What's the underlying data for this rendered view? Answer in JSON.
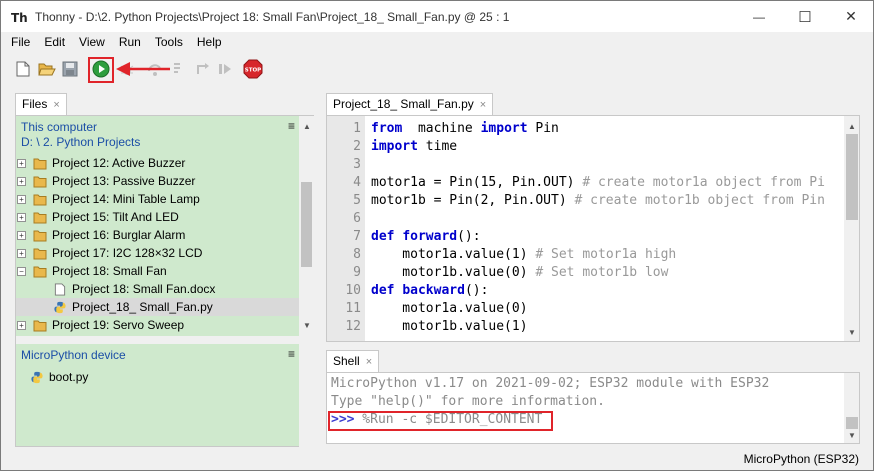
{
  "window": {
    "title": "Thonny  -  D:\\2. Python Projects\\Project 18:  Small Fan\\Project_18_ Small_Fan.py  @  25 : 1",
    "app_icon_text": "Th",
    "minimize": "—",
    "maximize": "☐",
    "close": "✕"
  },
  "menu": [
    "File",
    "Edit",
    "View",
    "Run",
    "Tools",
    "Help"
  ],
  "toolbar": {
    "stop_label": "STOP",
    "highlight_color": "#e0242a"
  },
  "files_panel": {
    "tab_label": "Files",
    "close": "×",
    "computer_label": "This computer",
    "computer_path": "D: \\ 2. Python Projects",
    "menu_glyph": "≡",
    "tree": [
      {
        "label": "Project 12:  Active Buzzer",
        "type": "folder",
        "exp": "+"
      },
      {
        "label": "Project 13:  Passive Buzzer",
        "type": "folder",
        "exp": "+"
      },
      {
        "label": "Project 14:  Mini Table Lamp",
        "type": "folder",
        "exp": "+"
      },
      {
        "label": "Project 15:  Tilt And LED",
        "type": "folder",
        "exp": "+"
      },
      {
        "label": "Project 16:  Burglar Alarm",
        "type": "folder",
        "exp": "+"
      },
      {
        "label": "Project 17:   I2C 128×32 LCD",
        "type": "folder",
        "exp": "+"
      },
      {
        "label": "Project 18:  Small Fan",
        "type": "folder",
        "exp": "−"
      },
      {
        "label": "Project 18:  Small Fan.docx",
        "type": "doc",
        "exp": ""
      },
      {
        "label": "Project_18_ Small_Fan.py",
        "type": "py",
        "exp": "",
        "selected": true
      },
      {
        "label": "Project 19:  Servo Sweep",
        "type": "folder",
        "exp": "+"
      }
    ],
    "device_label": "MicroPython device",
    "device_files": [
      "boot.py"
    ]
  },
  "editor": {
    "tab_label": "Project_18_ Small_Fan.py",
    "close": "×",
    "lines": [
      {
        "n": "1",
        "parts": [
          [
            "kw",
            "from"
          ],
          [
            "",
            "  machine "
          ],
          [
            "kw",
            "import"
          ],
          [
            "",
            " Pin"
          ]
        ]
      },
      {
        "n": "2",
        "parts": [
          [
            "kw",
            "import"
          ],
          [
            "",
            " time"
          ]
        ]
      },
      {
        "n": "3",
        "parts": []
      },
      {
        "n": "4",
        "parts": [
          [
            "",
            "motor1a = Pin(15, Pin.OUT) "
          ],
          [
            "cm",
            "# create motor1a object from Pi"
          ]
        ]
      },
      {
        "n": "5",
        "parts": [
          [
            "",
            "motor1b = Pin(2, Pin.OUT) "
          ],
          [
            "cm",
            "# create motor1b object from Pin"
          ]
        ]
      },
      {
        "n": "6",
        "parts": []
      },
      {
        "n": "7",
        "parts": [
          [
            "kw",
            "def"
          ],
          [
            "",
            " "
          ],
          [
            "kw",
            "forward"
          ],
          [
            "",
            "():"
          ]
        ]
      },
      {
        "n": "8",
        "parts": [
          [
            "",
            "    motor1a.value(1) "
          ],
          [
            "cm",
            "# Set motor1a high"
          ]
        ]
      },
      {
        "n": "9",
        "parts": [
          [
            "",
            "    motor1b.value(0) "
          ],
          [
            "cm",
            "# Set motor1b low"
          ]
        ]
      },
      {
        "n": "10",
        "parts": [
          [
            "kw",
            "def"
          ],
          [
            "",
            " "
          ],
          [
            "kw",
            "backward"
          ],
          [
            "",
            "():"
          ]
        ]
      },
      {
        "n": "11",
        "parts": [
          [
            "",
            "    motor1a.value(0)"
          ]
        ]
      },
      {
        "n": "12",
        "parts": [
          [
            "",
            "    motor1b.value(1)"
          ]
        ]
      }
    ]
  },
  "shell": {
    "tab_label": "Shell",
    "close": "×",
    "line1": "MicroPython v1.17 on 2021-09-02; ESP32 module with ESP32",
    "line2": "Type \"help()\" for more information.",
    "prompt": ">>>",
    "command": " %Run -c $EDITOR_CONTENT"
  },
  "status": {
    "interpreter": "MicroPython (ESP32)"
  }
}
